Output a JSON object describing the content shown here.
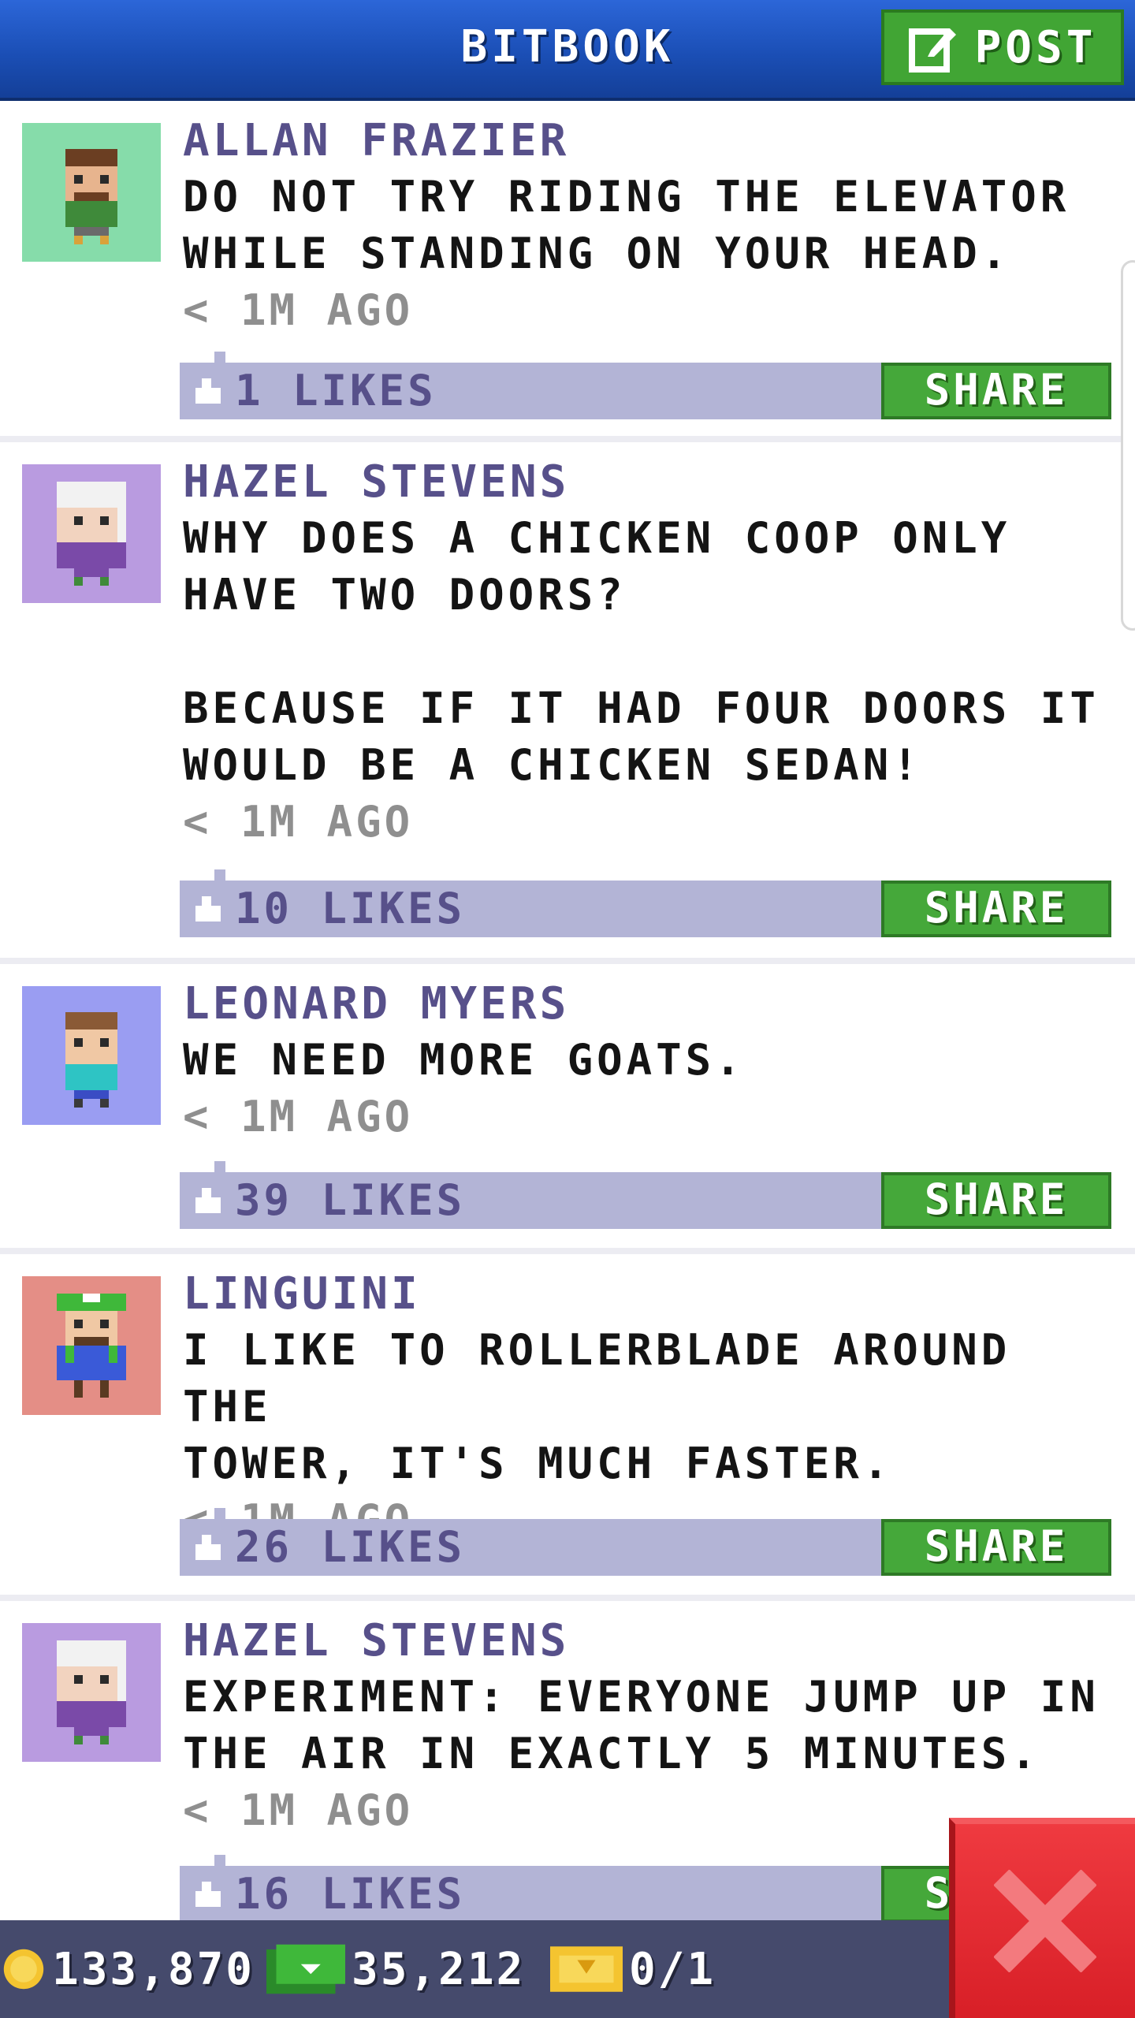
{
  "header": {
    "title": "BITBOOK",
    "post_label": "POST"
  },
  "posts": [
    {
      "author": "ALLAN FRAZIER",
      "text": "DO NOT TRY RIDING THE ELEVATOR\nWHILE STANDING ON YOUR HEAD.",
      "time": "< 1M AGO",
      "likes": "1 LIKES",
      "share_label": "SHARE",
      "avatar_bg": "#86dcaa"
    },
    {
      "author": "HAZEL STEVENS",
      "text": "WHY DOES A CHICKEN COOP ONLY\nHAVE TWO DOORS?\n\nBECAUSE IF IT HAD FOUR DOORS IT\nWOULD BE A CHICKEN SEDAN!",
      "time": "< 1M AGO",
      "likes": "10 LIKES",
      "share_label": "SHARE",
      "avatar_bg": "#b99be0"
    },
    {
      "author": "LEONARD MYERS",
      "text": "WE NEED MORE GOATS.",
      "time": "< 1M AGO",
      "likes": "39 LIKES",
      "share_label": "SHARE",
      "avatar_bg": "#9a9df2"
    },
    {
      "author": "LINGUINI",
      "text": "I LIKE TO ROLLERBLADE AROUND THE\nTOWER, IT'S MUCH FASTER.",
      "time": "< 1M AGO",
      "likes": "26 LIKES",
      "share_label": "SHARE",
      "avatar_bg": "#e48e86"
    },
    {
      "author": "HAZEL STEVENS",
      "text": "EXPERIMENT: EVERYONE JUMP UP IN\nTHE AIR IN EXACTLY 5 MINUTES.",
      "time": "< 1M AGO",
      "likes": "16 LIKES",
      "share_label": "SHARE",
      "avatar_bg": "#b99be0"
    }
  ],
  "status": {
    "coins": "133,870",
    "bux": "35,212",
    "tickets": "0/1"
  }
}
